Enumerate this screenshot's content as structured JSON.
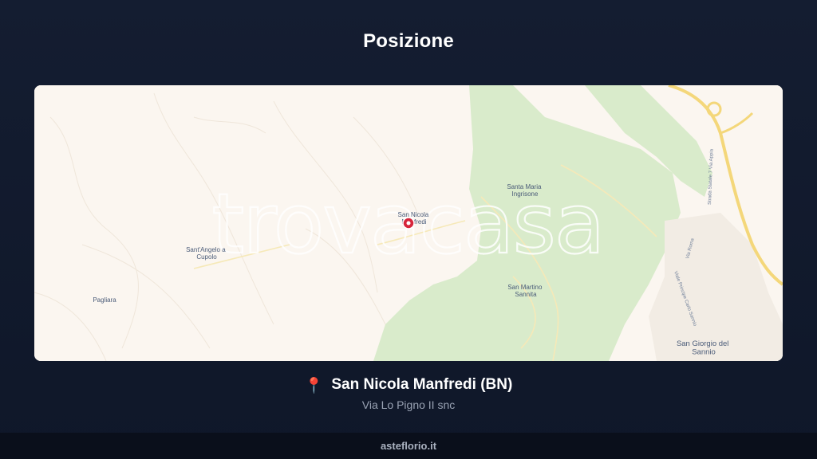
{
  "header": {
    "title": "Posizione"
  },
  "map": {
    "watermark": "trovacasa",
    "places": {
      "san_nicola": [
        "San Nicola",
        "Manfredi"
      ],
      "santa_maria": [
        "Santa Maria",
        "Ingrisone"
      ],
      "sant_angelo": [
        "Sant'Angelo a",
        "Cupolo"
      ],
      "pagliara": "Pagliara",
      "san_martino": [
        "San Martino",
        "Sannita"
      ],
      "san_giorgio": [
        "San Giorgio del",
        "Sannio"
      ]
    },
    "roads": {
      "statale": "Strada Statale 7 Via Appia",
      "via_roma": "Via Roma",
      "viale": "Viale Principe Carlo Sannio"
    },
    "colors": {
      "land": "#fbf6f0",
      "green": "#d9ebcb",
      "highway": "#f4d77a",
      "marker": "#d6263b"
    }
  },
  "location": {
    "pin_icon": "📍",
    "name": "San Nicola Manfredi (BN)",
    "address": "Via Lo Pigno II snc"
  },
  "footer": {
    "site": "asteflorio.it"
  }
}
